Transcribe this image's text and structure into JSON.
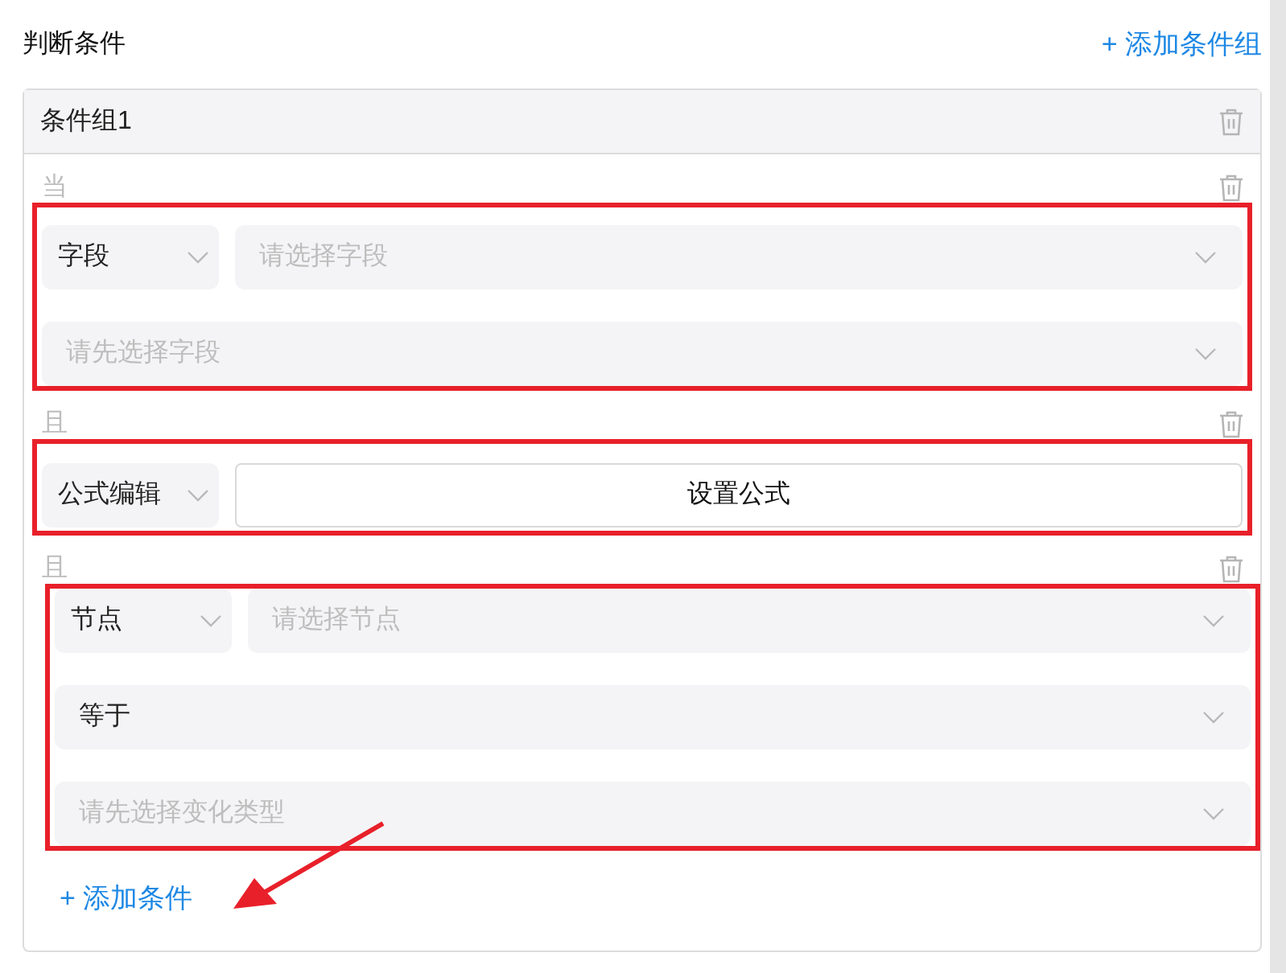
{
  "title": "判断条件",
  "add_group": {
    "icon": "+",
    "label": "添加条件组"
  },
  "group": {
    "title": "条件组1",
    "conditions": [
      {
        "connector": "当",
        "kind": "field",
        "highlighted": true,
        "type_select": "字段",
        "selects": [
          {
            "placeholder": "请选择字段"
          },
          {
            "placeholder": "请先选择字段"
          }
        ]
      },
      {
        "connector": "且",
        "kind": "formula",
        "highlighted": true,
        "type_select": "公式编辑",
        "button": "设置公式"
      },
      {
        "connector": "且",
        "kind": "node",
        "highlighted": true,
        "type_select": "节点",
        "selects": [
          {
            "placeholder": "请选择节点"
          },
          {
            "value": "等于"
          },
          {
            "placeholder": "请先选择变化类型"
          }
        ]
      }
    ],
    "add_condition": {
      "icon": "+",
      "label": "添加条件"
    }
  }
}
